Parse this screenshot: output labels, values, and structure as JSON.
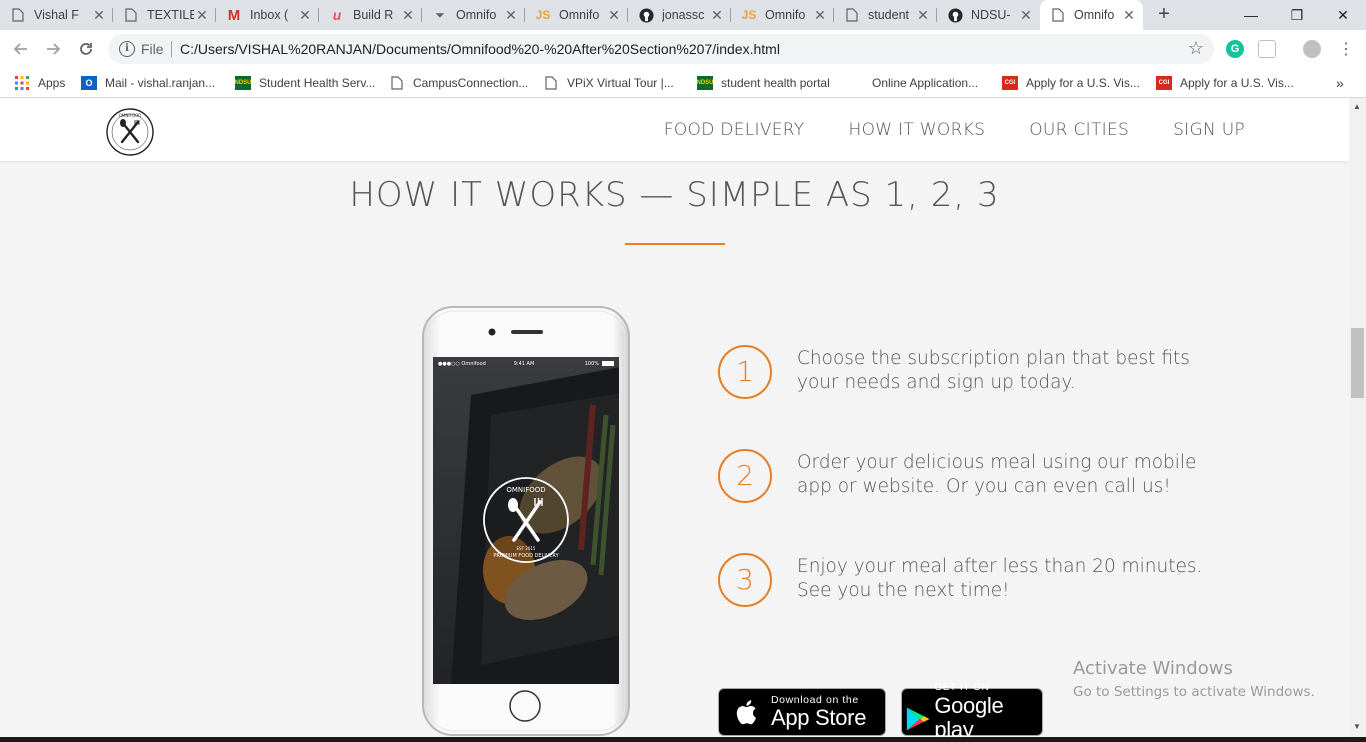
{
  "tabs": [
    {
      "title": "Vishal F",
      "icon": "page-icon"
    },
    {
      "title": "TEXTILE",
      "icon": "page-icon"
    },
    {
      "title": "Inbox (",
      "icon": "gmail-icon"
    },
    {
      "title": "Build R",
      "icon": "udemy-icon"
    },
    {
      "title": "Omnifo",
      "icon": "download-icon"
    },
    {
      "title": "Omnifo",
      "icon": "js-icon"
    },
    {
      "title": "jonassc",
      "icon": "github-icon"
    },
    {
      "title": "Omnifo",
      "icon": "js-icon"
    },
    {
      "title": "student",
      "icon": "page-icon"
    },
    {
      "title": "NDSU-",
      "icon": "github-icon"
    },
    {
      "title": "Omnifo",
      "icon": "page-icon",
      "active": true
    }
  ],
  "window": {
    "minimize": "—",
    "maximize": "❐",
    "close": "✕",
    "new_tab": "+"
  },
  "omnibox": {
    "label": "File",
    "url": "C:/Users/VISHAL%20RANJAN/Documents/Omnifood%20-%20After%20Section%207/index.html"
  },
  "bookmarks": [
    {
      "label": "Apps",
      "icon": "apps-icon"
    },
    {
      "label": "Mail - vishal.ranjan...",
      "icon": "outlook-icon"
    },
    {
      "label": "Student Health Serv...",
      "icon": "ndsu-icon"
    },
    {
      "label": "CampusConnection...",
      "icon": "page-icon"
    },
    {
      "label": "VPiX Virtual Tour |...",
      "icon": "page-icon"
    },
    {
      "label": "student health portal",
      "icon": "ndsu-icon"
    },
    {
      "label": "Online Application...",
      "icon": "blank-icon"
    },
    {
      "label": "Apply for a U.S. Vis...",
      "icon": "cgi-icon"
    },
    {
      "label": "Apply for a U.S. Vis...",
      "icon": "cgi-icon"
    }
  ],
  "site": {
    "logo_text_top": "OMNIFOOD",
    "nav": [
      "FOOD DELIVERY",
      "HOW IT WORKS",
      "OUR CITIES",
      "SIGN UP"
    ],
    "section_title": "HOW IT WORKS — SIMPLE AS 1, 2, 3",
    "steps": [
      {
        "num": "1",
        "text": "Choose the subscription plan that best fits your needs and sign up today."
      },
      {
        "num": "2",
        "text": "Order your delicious meal using our mobile app or website. Or you can even call us!"
      },
      {
        "num": "3",
        "text": "Enjoy your meal after less than 20 minutes. See you the next time!"
      }
    ],
    "phone": {
      "carrier": "●●●○○ Omnifood",
      "time": "9:41 AM",
      "battery": "100%",
      "logo_top": "OMNIFOOD",
      "logo_bottom": "PREMIUM FOOD DELIVERY",
      "logo_est": "EST 2015"
    },
    "app_store": {
      "small": "Download on the",
      "big": "App Store"
    },
    "google_play": {
      "small": "GET IT ON",
      "big": "Google play"
    }
  },
  "watermark": {
    "title": "Activate Windows",
    "subtitle": "Go to Settings to activate Windows."
  },
  "colors": {
    "accent": "#e67e22",
    "text": "#555555",
    "page_bg": "#f4f4f4"
  }
}
